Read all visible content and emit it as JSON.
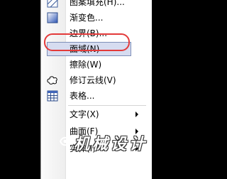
{
  "menu": {
    "items": [
      {
        "label": "图案填充(H)...",
        "icon": "hatch-icon"
      },
      {
        "label": "渐变色...",
        "icon": "gradient-icon"
      },
      {
        "label": "边界(B)...",
        "icon": ""
      },
      {
        "label": "面域(N)",
        "icon": "",
        "selected": true
      },
      {
        "label": "擦除(W)",
        "icon": ""
      },
      {
        "label": "修订云线(V)",
        "icon": "revcloud-icon"
      },
      {
        "label": "表格...",
        "icon": "table-icon"
      },
      {
        "label": "文字(X)",
        "icon": "",
        "submenu": true
      },
      {
        "label": "曲面(F)",
        "icon": "",
        "submenu": true
      },
      {
        "label": "实体(I)",
        "icon": "",
        "submenu": true
      }
    ]
  },
  "annotation": {
    "highlight_color": "#e33a3a"
  },
  "watermark": {
    "text": "机械设计"
  }
}
